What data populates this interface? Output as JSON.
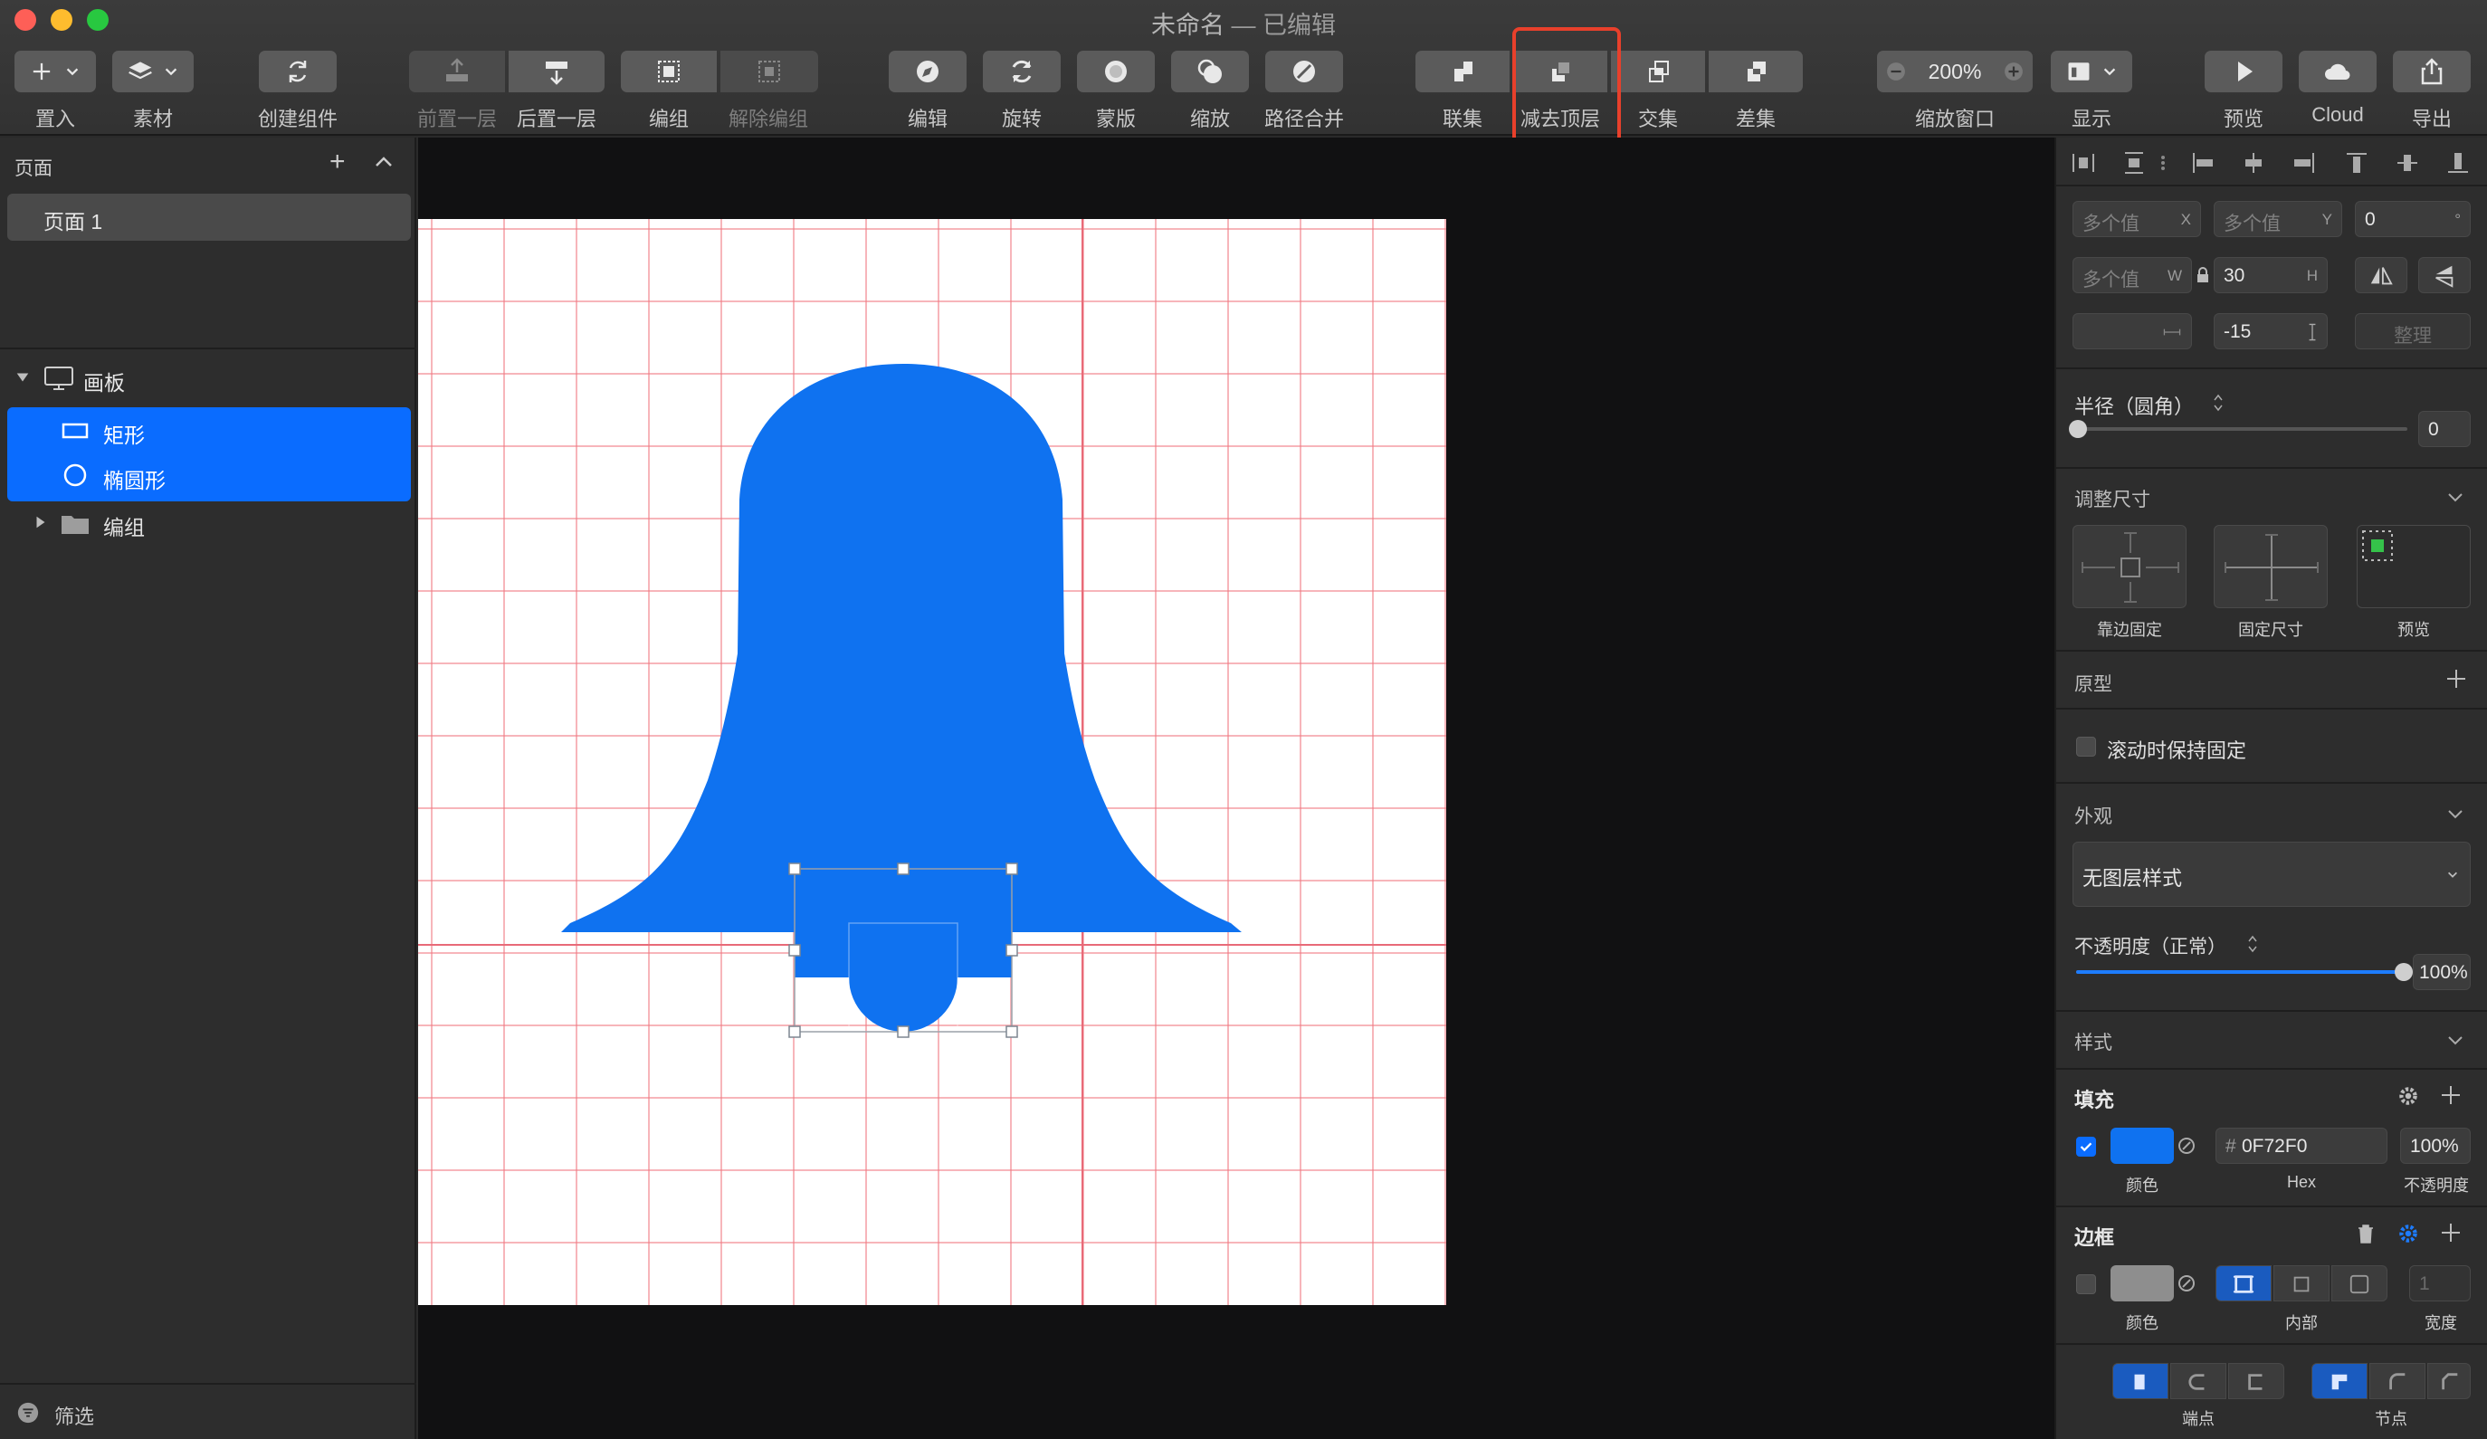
{
  "window": {
    "title": "未命名",
    "title_suffix": " — 已编辑"
  },
  "toolbar": {
    "insert": "置入",
    "assets": "素材",
    "create_component": "创建组件",
    "bring_forward": "前置一层",
    "send_backward": "后置一层",
    "group": "编组",
    "ungroup": "解除编组",
    "edit": "编辑",
    "rotate": "旋转",
    "mask": "蒙版",
    "scale": "缩放",
    "flatten": "路径合并",
    "union": "联集",
    "subtract": "减去顶层",
    "intersect": "交集",
    "difference": "差集",
    "zoom_value": "200%",
    "zoom_label": "缩放窗口",
    "view": "显示",
    "preview": "预览",
    "cloud": "Cloud",
    "export": "导出"
  },
  "left_panel": {
    "pages_title": "页面",
    "page_1": "页面 1",
    "artboard_layer": "画板",
    "layers": [
      "矩形",
      "椭圆形",
      "编组"
    ],
    "filter": "筛选"
  },
  "inspector": {
    "x_field": "多个值",
    "x_label": "X",
    "y_field": "多个值",
    "y_label": "Y",
    "rotation": "0",
    "rotation_unit": "°",
    "w_field": "多个值",
    "w_label": "W",
    "h_value": "30",
    "h_label": "H",
    "spacing_value": "-15",
    "tidy_button": "整理",
    "radius_label": "半径（圆角）",
    "radius_value": "0",
    "resizing_title": "调整尺寸",
    "pin_edges": "靠边固定",
    "fixed_size": "固定尺寸",
    "preview": "预览",
    "prototype_title": "原型",
    "fix_on_scroll": "滚动时保持固定",
    "appearance_title": "外观",
    "layer_style": "无图层样式",
    "opacity_label": "不透明度（正常）",
    "opacity_value": "100%",
    "opacity_fraction": 1.0,
    "style_title": "样式",
    "fill_title": "填充",
    "fill_color_label": "颜色",
    "fill_hex": "0F72F0",
    "fill_hex_prefix": "#",
    "fill_hex_label": "Hex",
    "fill_opacity": "100%",
    "fill_opacity_label": "不透明度",
    "border_title": "边框",
    "border_color_label": "颜色",
    "border_position_label": "内部",
    "border_width_value": "1",
    "border_width_label": "宽度",
    "ends_label": "端点",
    "joins_label": "节点"
  },
  "colors": {
    "accent": "#0a6cff",
    "shape_fill": "#0f72f0",
    "highlight": "#e8402b",
    "grid": "#f07882"
  }
}
